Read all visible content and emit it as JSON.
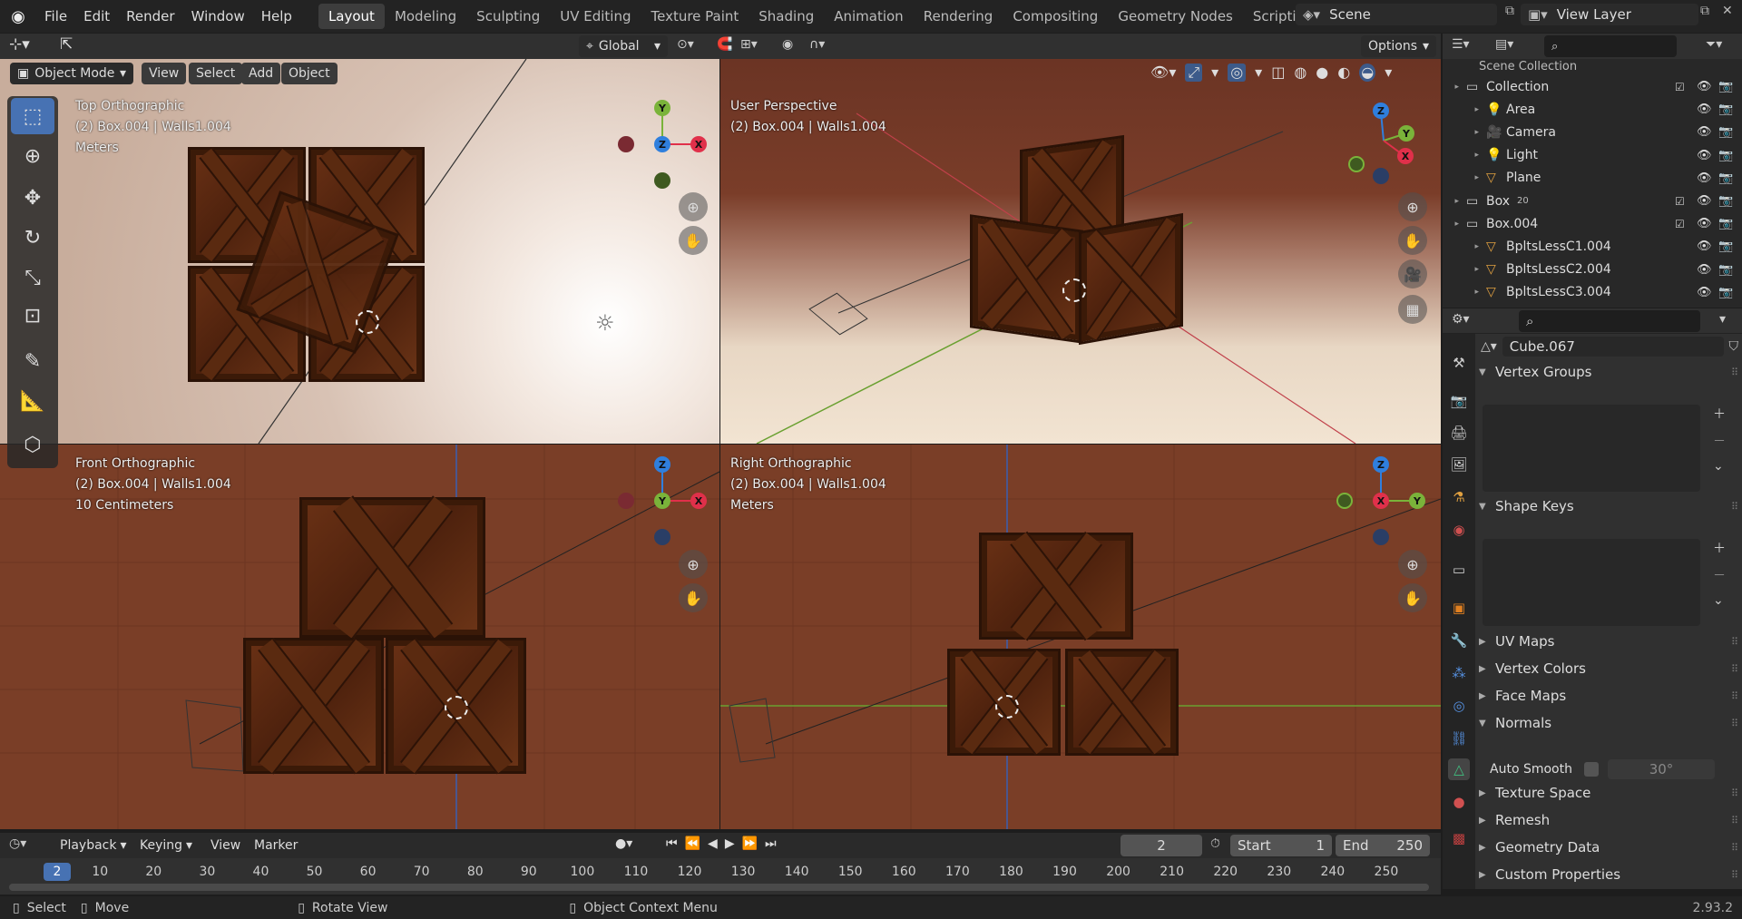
{
  "topbar": {
    "menus": [
      "File",
      "Edit",
      "Render",
      "Window",
      "Help"
    ],
    "workspaces": [
      "Layout",
      "Modeling",
      "Sculpting",
      "UV Editing",
      "Texture Paint",
      "Shading",
      "Animation",
      "Rendering",
      "Compositing",
      "Geometry Nodes",
      "Scripting"
    ],
    "active_workspace": "Layout",
    "add_tab": "+",
    "scene": "Scene",
    "view_layer": "View Layer"
  },
  "header": {
    "transform_orientation": "Global",
    "options": "Options",
    "mode": "Object Mode",
    "menus": [
      "View",
      "Select",
      "Add",
      "Object"
    ]
  },
  "viewports": [
    {
      "name": "Top Orthographic",
      "object": "(2) Box.004 | Walls1.004",
      "scale": "Meters"
    },
    {
      "name": "User Perspective",
      "object": "(2) Box.004 | Walls1.004",
      "scale": ""
    },
    {
      "name": "Front Orthographic",
      "object": "(2) Box.004 | Walls1.004",
      "scale": "10 Centimeters"
    },
    {
      "name": "Right Orthographic",
      "object": "(2) Box.004 | Walls1.004",
      "scale": "Meters"
    }
  ],
  "axes": {
    "x": "X",
    "y": "Y",
    "z": "Z",
    "colors": {
      "x": "#e0304a",
      "y": "#7ab33a",
      "z": "#2f7fdd"
    }
  },
  "outliner": {
    "search_placeholder": "",
    "root": "Scene Collection",
    "rows": [
      {
        "label": "Collection",
        "level": 1,
        "type": "collection",
        "badge": ""
      },
      {
        "label": "Area",
        "level": 2,
        "type": "light",
        "badge": ""
      },
      {
        "label": "Camera",
        "level": 2,
        "type": "camera",
        "badge": ""
      },
      {
        "label": "Light",
        "level": 2,
        "type": "light",
        "badge": ""
      },
      {
        "label": "Plane",
        "level": 2,
        "type": "mesh",
        "badge": ""
      },
      {
        "label": "Box",
        "level": 1,
        "type": "collection",
        "badge": "20"
      },
      {
        "label": "Box.004",
        "level": 1,
        "type": "collection",
        "badge": ""
      },
      {
        "label": "BpltsLessC1.004",
        "level": 2,
        "type": "mesh",
        "badge": ""
      },
      {
        "label": "BpltsLessC2.004",
        "level": 2,
        "type": "mesh",
        "badge": ""
      },
      {
        "label": "BpltsLessC3.004",
        "level": 2,
        "type": "mesh",
        "badge": ""
      }
    ]
  },
  "properties": {
    "mesh_name": "Cube.067",
    "panels": [
      {
        "label": "Vertex Groups",
        "open": true
      },
      {
        "label": "Shape Keys",
        "open": true
      },
      {
        "label": "UV Maps",
        "open": false
      },
      {
        "label": "Vertex Colors",
        "open": false
      },
      {
        "label": "Face Maps",
        "open": false
      },
      {
        "label": "Normals",
        "open": true
      },
      {
        "label": "Texture Space",
        "open": false
      },
      {
        "label": "Remesh",
        "open": false
      },
      {
        "label": "Geometry Data",
        "open": false
      },
      {
        "label": "Custom Properties",
        "open": false
      }
    ],
    "auto_smooth_label": "Auto Smooth",
    "auto_smooth_angle": "30°"
  },
  "timeline": {
    "menus": [
      "Playback",
      "Keying",
      "View",
      "Marker"
    ],
    "current_frame": "2",
    "start_label": "Start",
    "start": "1",
    "end_label": "End",
    "end": "250",
    "ticks": [
      "10",
      "20",
      "30",
      "40",
      "50",
      "60",
      "70",
      "80",
      "90",
      "100",
      "110",
      "120",
      "130",
      "140",
      "150",
      "160",
      "170",
      "180",
      "190",
      "200",
      "210",
      "220",
      "230",
      "240",
      "250"
    ]
  },
  "statusbar": {
    "select": "Select",
    "move": "Move",
    "rotate": "Rotate View",
    "context": "Object Context Menu",
    "version": "2.93.2"
  }
}
